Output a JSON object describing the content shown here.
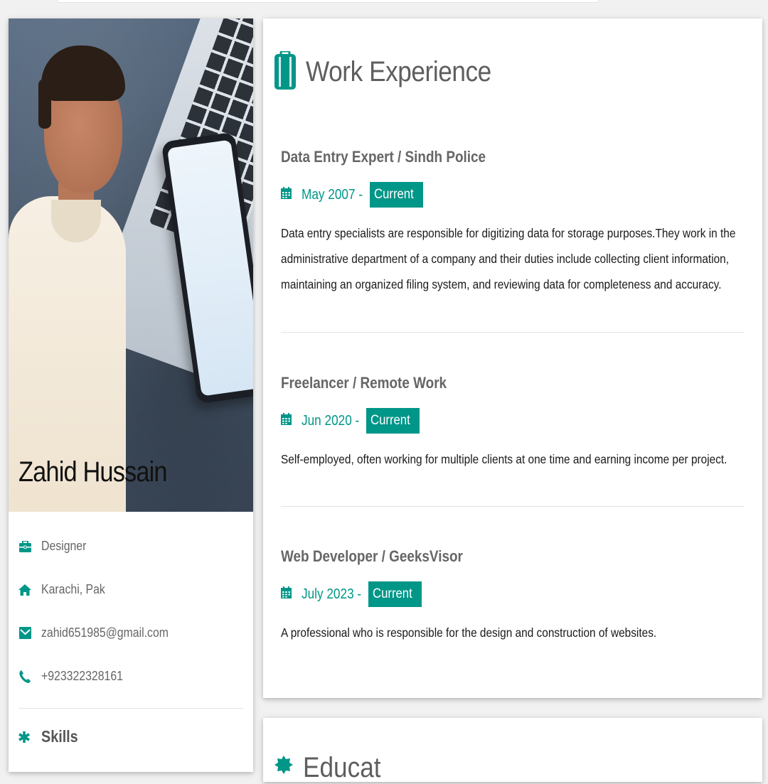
{
  "profile": {
    "name": "Zahid Hussain",
    "info": {
      "role": "Designer",
      "location": "Karachi, Pak",
      "email": "zahid651985@gmail.com",
      "phone": "+923322328161"
    },
    "skills_label": "Skills"
  },
  "experience": {
    "title": "Work Experience",
    "jobs": [
      {
        "title": "Data Entry Expert / Sindh Police",
        "date": "May 2007 -",
        "badge": "Current",
        "description": "Data entry specialists are responsible for digitizing data for storage purposes.They work in the administrative department of a company and their duties include collecting client information, maintaining an organized filing system, and reviewing data for completeness and accuracy."
      },
      {
        "title": "Freelancer / Remote Work",
        "date": "Jun 2020 -",
        "badge": "Current",
        "description": "Self-employed, often working for multiple clients at one time and earning income per project."
      },
      {
        "title": "Web Developer / GeeksVisor",
        "date": "July 2023 -",
        "badge": "Current",
        "description": "A professional who is responsible for the design and construction of websites."
      }
    ]
  },
  "education": {
    "title": "Educat"
  },
  "colors": {
    "accent": "#009688",
    "background": "#f1f1f1",
    "card": "#ffffff"
  },
  "icons": {
    "role": "briefcase-icon",
    "location": "home-icon",
    "email": "envelope-icon",
    "phone": "phone-icon",
    "skills": "asterisk-icon",
    "section": "suitcase-icon",
    "date": "calendar-icon",
    "education": "certificate-icon"
  }
}
